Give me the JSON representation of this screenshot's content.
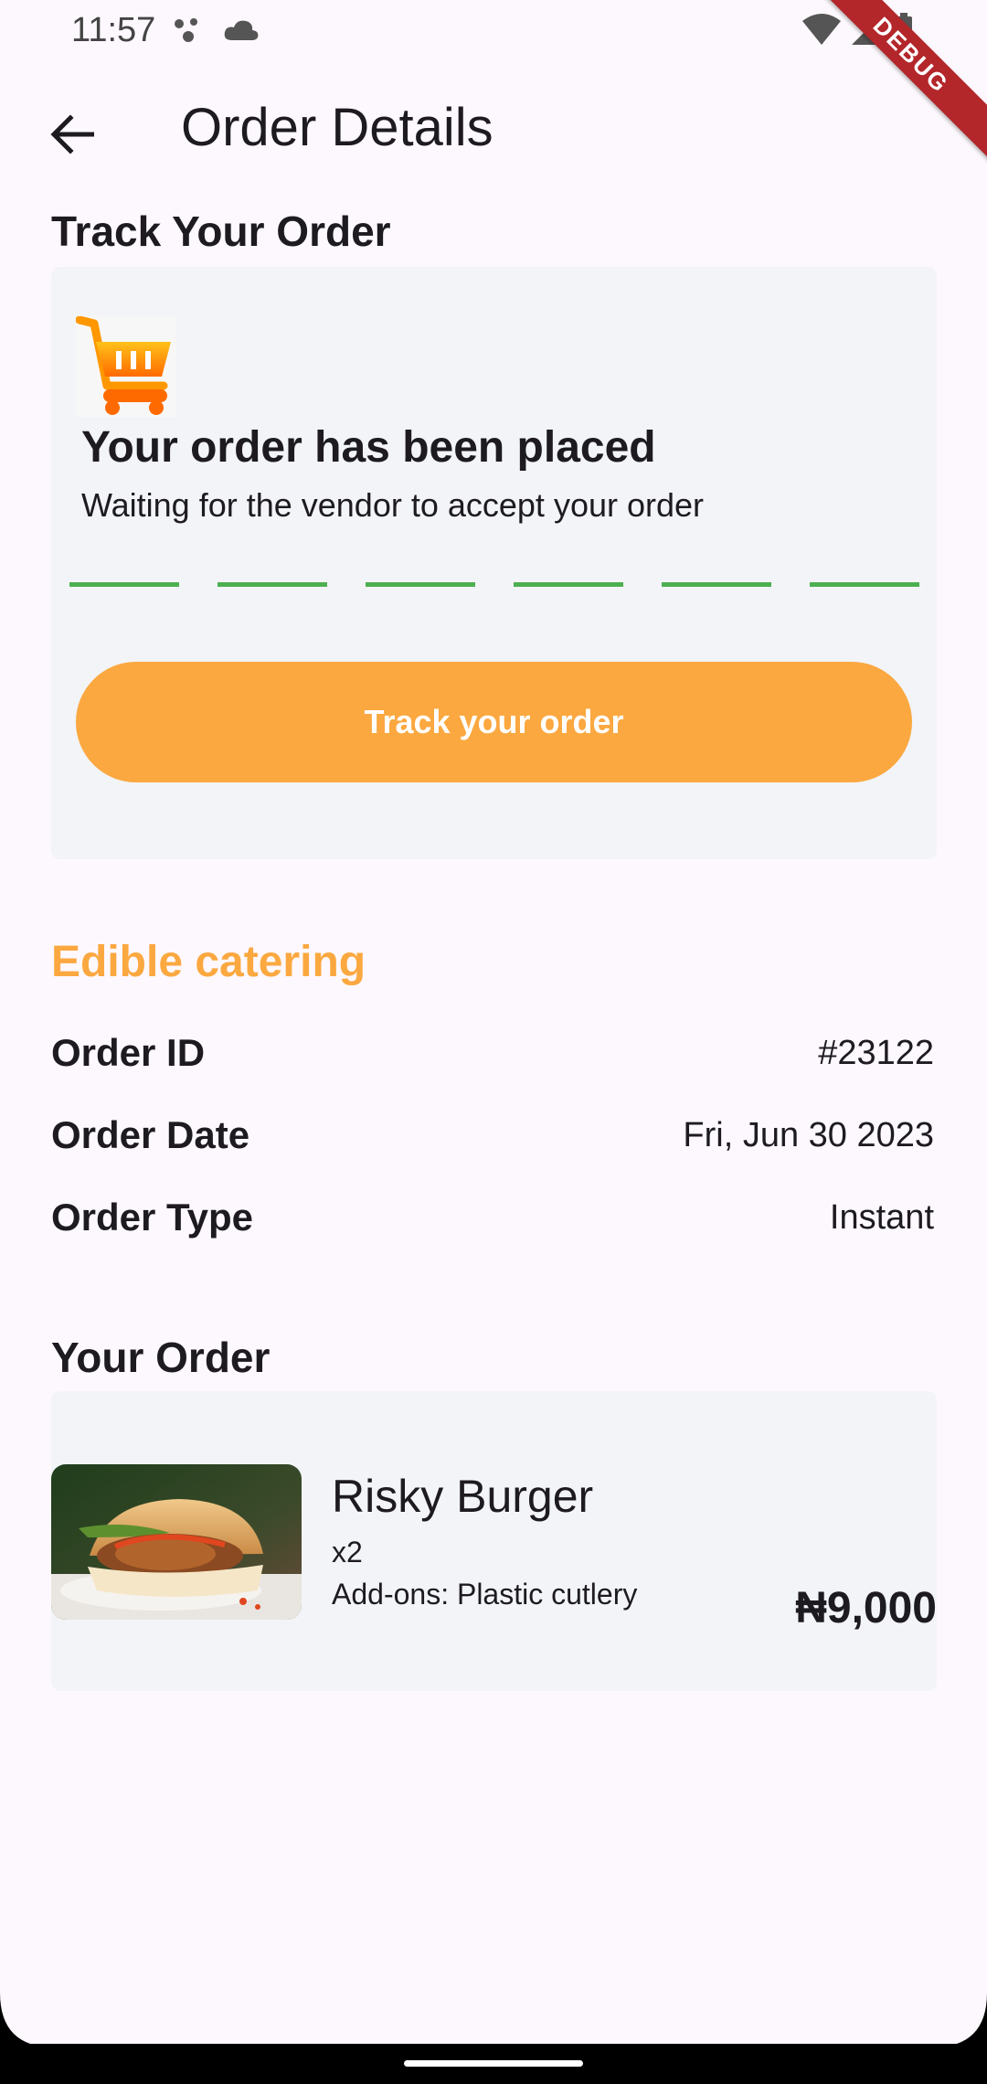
{
  "status_bar": {
    "time": "11:57",
    "icons": [
      "assistant-dots-icon",
      "cloud-icon",
      "wifi-icon",
      "signal-icon",
      "battery-icon"
    ]
  },
  "debug_banner": "DEBUG",
  "app_bar": {
    "back_icon": "arrow-left-icon",
    "title": "Order Details"
  },
  "track_section": {
    "title": "Track Your Order",
    "icon": "shopping-cart-icon",
    "status_title": "Your order has been placed",
    "status_subtitle": "Waiting for the vendor to accept your order",
    "progress_steps": 6,
    "button_label": "Track your order"
  },
  "vendor": {
    "name": "Edible catering"
  },
  "order_info": [
    {
      "label": "Order ID",
      "value": "#23122"
    },
    {
      "label": "Order Date",
      "value": "Fri, Jun 30 2023"
    },
    {
      "label": "Order Type",
      "value": "Instant"
    }
  ],
  "your_order": {
    "title": "Your Order",
    "item": {
      "name": "Risky Burger",
      "quantity": "x2",
      "addons": "Add-ons: Plastic cutlery",
      "price": "₦9,000"
    }
  },
  "colors": {
    "accent": "#fba840",
    "progress": "#4caf50",
    "card_bg": "#f2f4f7",
    "page_bg": "#fdf8fd"
  }
}
